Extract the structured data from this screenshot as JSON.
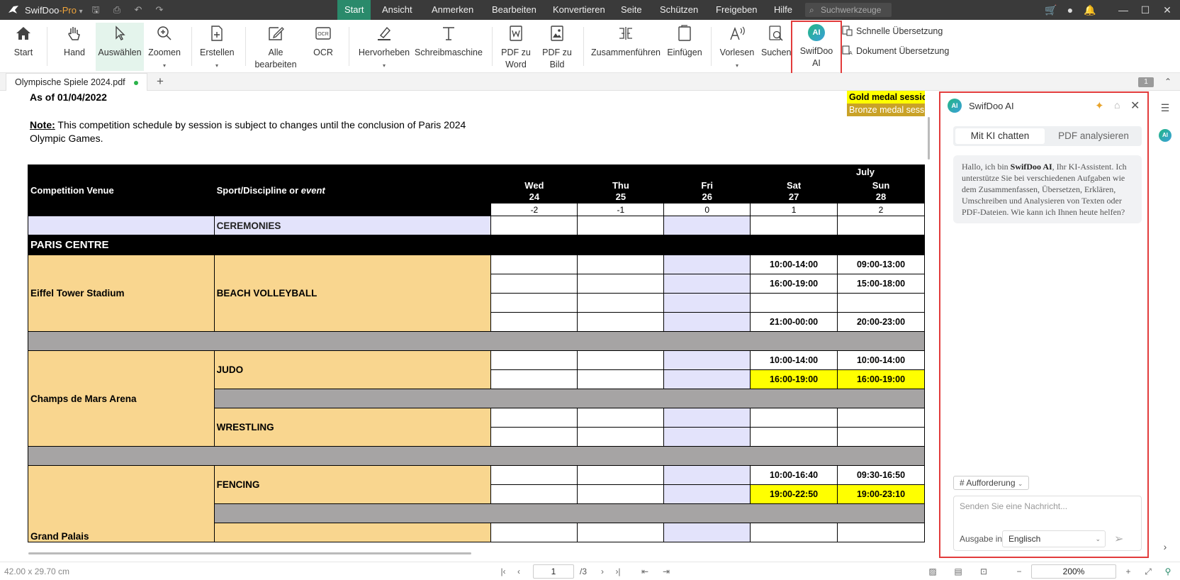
{
  "app": {
    "name": "SwifDoo",
    "edition": "-Pro"
  },
  "menu": [
    "Start",
    "Ansicht",
    "Anmerken",
    "Bearbeiten",
    "Konvertieren",
    "Seite",
    "Schützen",
    "Freigeben",
    "Hilfe"
  ],
  "search_tools_placeholder": "Suchwerkzeuge",
  "ribbon": {
    "start": "Start",
    "hand": "Hand",
    "select": "Auswählen",
    "zoom": "Zoomen",
    "create": "Erstellen",
    "edit_all_1": "Alle",
    "edit_all_2": "bearbeiten",
    "ocr": "OCR",
    "highlight": "Hervorheben",
    "typewriter": "Schreibmaschine",
    "pdf_word_1": "PDF zu",
    "pdf_word_2": "Word",
    "pdf_image_1": "PDF zu",
    "pdf_image_2": "Bild",
    "merge": "Zusammenführen",
    "insert": "Einfügen",
    "read_aloud": "Vorlesen",
    "search": "Suchen",
    "swifdoo_ai_1": "SwifDoo",
    "swifdoo_ai_2": "AI",
    "quick_translate": "Schnelle Übersetzung",
    "doc_translate": "Dokument Übersetzung",
    "ocr_icon_text": "OCR",
    "ai_badge": "AI"
  },
  "tab": {
    "title": "Olympische Spiele 2024.pdf",
    "page_badge": "1"
  },
  "document": {
    "as_of": "As of 01/04/2022",
    "note_label": "Note:",
    "note_text": " This competition schedule by session is subject to changes until the conclusion of Paris 2024 Olympic Games.",
    "legend_gold": "Gold medal session",
    "legend_bronze": "Bronze medal session",
    "header": {
      "venue": "Competition Venue",
      "sport": "Sport/Discipline or",
      "sport_italic": "event",
      "month": "July",
      "days": [
        {
          "dow": "Wed",
          "date": "24",
          "rel": "-2"
        },
        {
          "dow": "Thu",
          "date": "25",
          "rel": "-1"
        },
        {
          "dow": "Fri",
          "date": "26",
          "rel": "0"
        },
        {
          "dow": "Sat",
          "date": "27",
          "rel": "1"
        },
        {
          "dow": "Sun",
          "date": "28",
          "rel": "2"
        }
      ]
    },
    "ceremonies": "CEREMONIES",
    "section": "PARIS CENTRE",
    "venues": {
      "eiffel": "Eiffel Tower Stadium",
      "champs": "Champs de Mars Arena",
      "grand": "Grand Palais"
    },
    "sports": {
      "beach": "BEACH VOLLEYBALL",
      "judo": "JUDO",
      "wrestling": "WRESTLING",
      "fencing": "FENCING"
    },
    "times": {
      "bv_sat_1": "10:00-14:00",
      "bv_sun_1": "09:00-13:00",
      "bv_sat_2": "16:00-19:00",
      "bv_sun_2": "15:00-18:00",
      "bv_sat_4": "21:00-00:00",
      "bv_sun_4": "20:00-23:00",
      "judo_sat_1": "10:00-14:00",
      "judo_sun_1": "10:00-14:00",
      "judo_sat_2": "16:00-19:00",
      "judo_sun_2": "16:00-19:00",
      "fen_sat_1": "10:00-16:40",
      "fen_sun_1": "09:30-16:50",
      "fen_sat_2": "19:00-22:50",
      "fen_sun_2": "19:00-23:10"
    }
  },
  "ai_panel": {
    "title": "SwifDoo AI",
    "tab_chat": "Mit KI chatten",
    "tab_analyze": "PDF analysieren",
    "greeting_pre": "Hallo, ich bin ",
    "greeting_name": "SwifDoo AI",
    "greeting_post": ", Ihr KI-Assistent. Ich unterstütze Sie bei verschiedenen Aufgaben wie dem Zusammenfassen, Übersetzen, Erklären, Umschreiben und Analysieren von Texten oder PDF-Dateien. Wie kann ich Ihnen heute helfen?",
    "prompt_chip": "# Aufforderung",
    "input_placeholder": "Senden Sie eine Nachricht...",
    "output_label": "Ausgabe in",
    "output_language": "Englisch"
  },
  "status": {
    "page_size": "42.00 x 29.70 cm",
    "page_current": "1",
    "page_total": "/3",
    "zoom": "200%"
  },
  "colors": {
    "accent": "#2a8a6b",
    "highlight_border": "#e23b3b",
    "gold": "#ffff00",
    "bronze": "#c9a227",
    "venue_bg": "#f9d68f",
    "fri_bg": "#e3e3fb"
  }
}
